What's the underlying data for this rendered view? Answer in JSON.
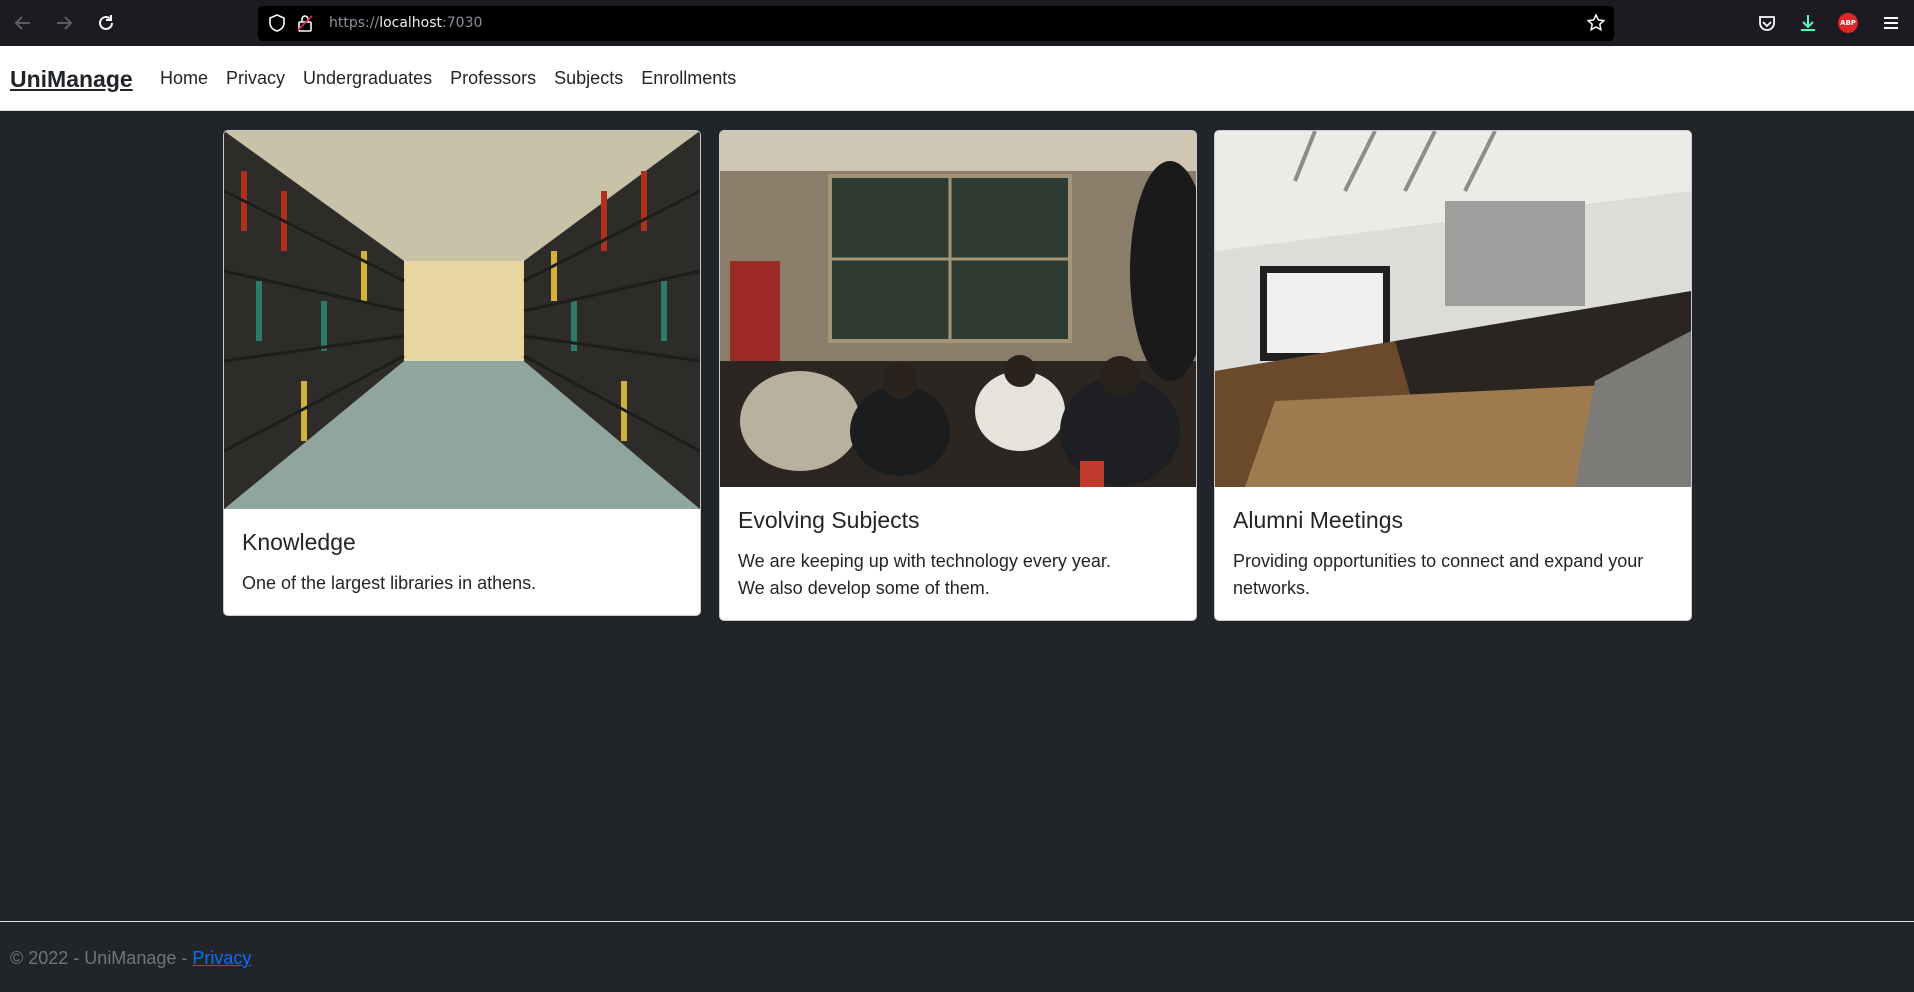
{
  "browser": {
    "url_prefix": "https://",
    "url_host": "localhost",
    "url_port": ":7030"
  },
  "navbar": {
    "brand": "UniManage",
    "links": [
      "Home",
      "Privacy",
      "Undergraduates",
      "Professors",
      "Subjects",
      "Enrollments"
    ]
  },
  "cards": [
    {
      "image_icon": "library-bookshelves-photo",
      "title": "Knowledge",
      "text": "One of the largest libraries in athens."
    },
    {
      "image_icon": "classroom-students-photo",
      "title": "Evolving Subjects",
      "text_line1": "We are keeping up with technology every year.",
      "text_line2": "We also develop some of them."
    },
    {
      "image_icon": "lecture-hall-photo",
      "title": "Alumni Meetings",
      "text": "Providing opportunities to connect and expand your networks."
    }
  ],
  "footer": {
    "copyright": "© 2022 - UniManage - ",
    "link": "Privacy"
  }
}
